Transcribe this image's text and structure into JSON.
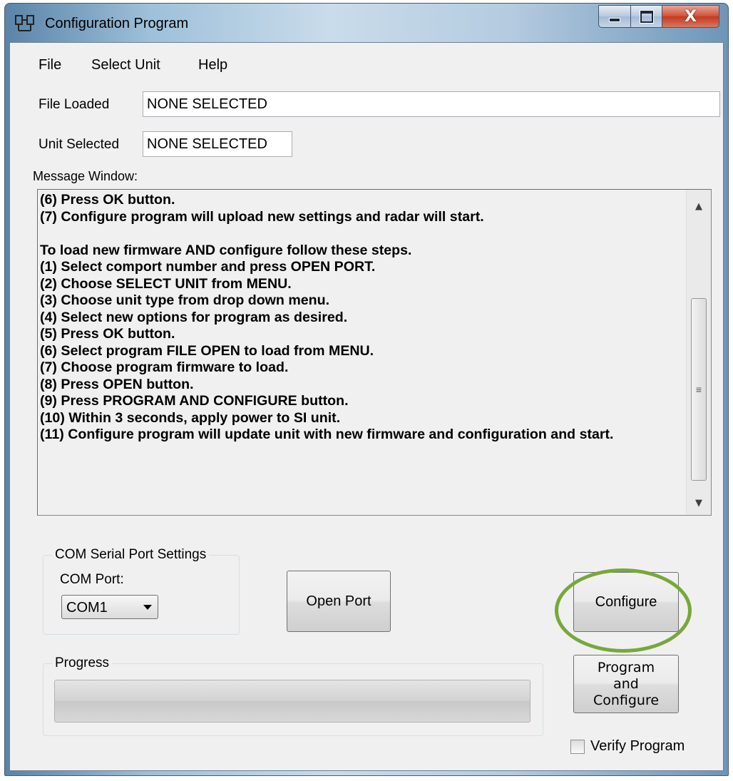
{
  "window": {
    "title": "Configuration Program",
    "close_glyph": "X"
  },
  "menu": [
    "File",
    "Select Unit",
    "Help"
  ],
  "file_loaded": {
    "label": "File Loaded",
    "value": "NONE SELECTED"
  },
  "unit_selected": {
    "label": "Unit Selected",
    "value": "NONE SELECTED"
  },
  "message_window": {
    "label": "Message Window:",
    "lines": [
      "(6) Press OK button.",
      "(7) Configure program will upload new settings and radar will start.",
      "",
      "To load new firmware AND configure follow these steps.",
      "(1) Select comport number and press OPEN PORT.",
      "(2) Choose SELECT UNIT from MENU.",
      "(3) Choose unit type from drop down menu.",
      "(4) Select new options for program as desired.",
      "(5) Press OK button.",
      "(6) Select program FILE OPEN to load from MENU.",
      "(7) Choose program firmware to load.",
      "(8) Press OPEN button.",
      "(9) Press PROGRAM AND CONFIGURE button.",
      "(10) Within 3 seconds, apply power to SI unit.",
      "(11) Configure program will update unit with new firmware and configuration and start."
    ]
  },
  "com_settings": {
    "group_title": "COM Serial Port Settings",
    "port_label": "COM Port:",
    "port_value": "COM1"
  },
  "buttons": {
    "open_port": "Open Port",
    "configure": "Configure",
    "program_and_configure": [
      "Program",
      "and",
      "Configure"
    ]
  },
  "progress": {
    "group_title": "Progress",
    "value": 0
  },
  "verify_program": {
    "label": "Verify Program",
    "checked": false
  },
  "colors": {
    "highlight_ring": "#77a83a"
  }
}
